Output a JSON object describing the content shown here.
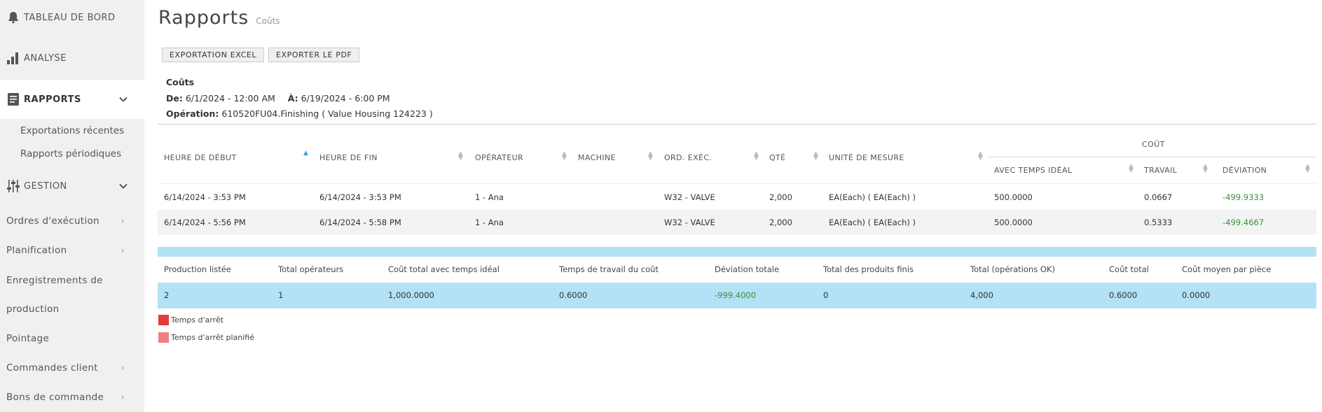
{
  "sidebar": {
    "dashboard": "TABLEAU DE BORD",
    "analysis": "ANALYSE",
    "reports": "RAPPORTS",
    "report_sub": [
      "Exportations récentes",
      "Rapports périodiques"
    ],
    "management": "GESTION",
    "links": [
      "Ordres d'exécution",
      "Planification",
      "Enregistrements de",
      "production",
      "Pointage",
      "Commandes client",
      "Bons de commande"
    ]
  },
  "page": {
    "title": "Rapports",
    "subtitle": "Coûts"
  },
  "buttons": {
    "excel": "EXPORTATION EXCEL",
    "pdf": "EXPORTER LE PDF"
  },
  "info": {
    "heading": "Coûts",
    "from_label": "De:",
    "from_value": "6/1/2024 - 12:00 AM",
    "to_label": "À:",
    "to_value": "6/19/2024 - 6:00 PM",
    "op_label": "Opération:",
    "op_value": "610520FU04.Finishing ( Value Housing 124223 )"
  },
  "table": {
    "group_header": "COÛT",
    "headers": [
      "HEURE DE DÉBUT",
      "HEURE DE FIN",
      "OPÉRATEUR",
      "MACHINE",
      "ORD. EXÉC.",
      "QTÉ",
      "UNITÉ DE MESURE",
      "AVEC TEMPS IDÉAL",
      "TRAVAIL",
      "DÉVIATION"
    ],
    "rows": [
      [
        "6/14/2024 - 3:53 PM",
        "6/14/2024 - 3:53 PM",
        "1 - Ana",
        "",
        "W32 - VALVE",
        "2,000",
        "EA(Each) ( EA(Each) )",
        "500.0000",
        "0.0667",
        "-499.9333"
      ],
      [
        "6/14/2024 - 5:56 PM",
        "6/14/2024 - 5:58 PM",
        "1 - Ana",
        "",
        "W32 - VALVE",
        "2,000",
        "EA(Each) ( EA(Each) )",
        "500.0000",
        "0.5333",
        "-499.4667"
      ]
    ]
  },
  "summary": {
    "headers": [
      "Production listée",
      "Total opérateurs",
      "Coût total avec temps idéal",
      "Temps de travail du coût",
      "Déviation totale",
      "Total des produits finis",
      "Total (opérations OK)",
      "Coût total",
      "Coût moyen par pièce"
    ],
    "values": [
      "2",
      "1",
      "1,000.0000",
      "0.6000",
      "-999.4000",
      "0",
      "4,000",
      "0.6000",
      "0.0000"
    ]
  },
  "legend": [
    {
      "label": "Temps d'arrêt",
      "color": "#e83a3a"
    },
    {
      "label": "Temps d'arrêt planifié",
      "color": "#f08080"
    }
  ],
  "colors": {
    "accent": "#3aa0d8",
    "summary_bg": "#b3e1f5",
    "negative": "#3b8f3b"
  }
}
